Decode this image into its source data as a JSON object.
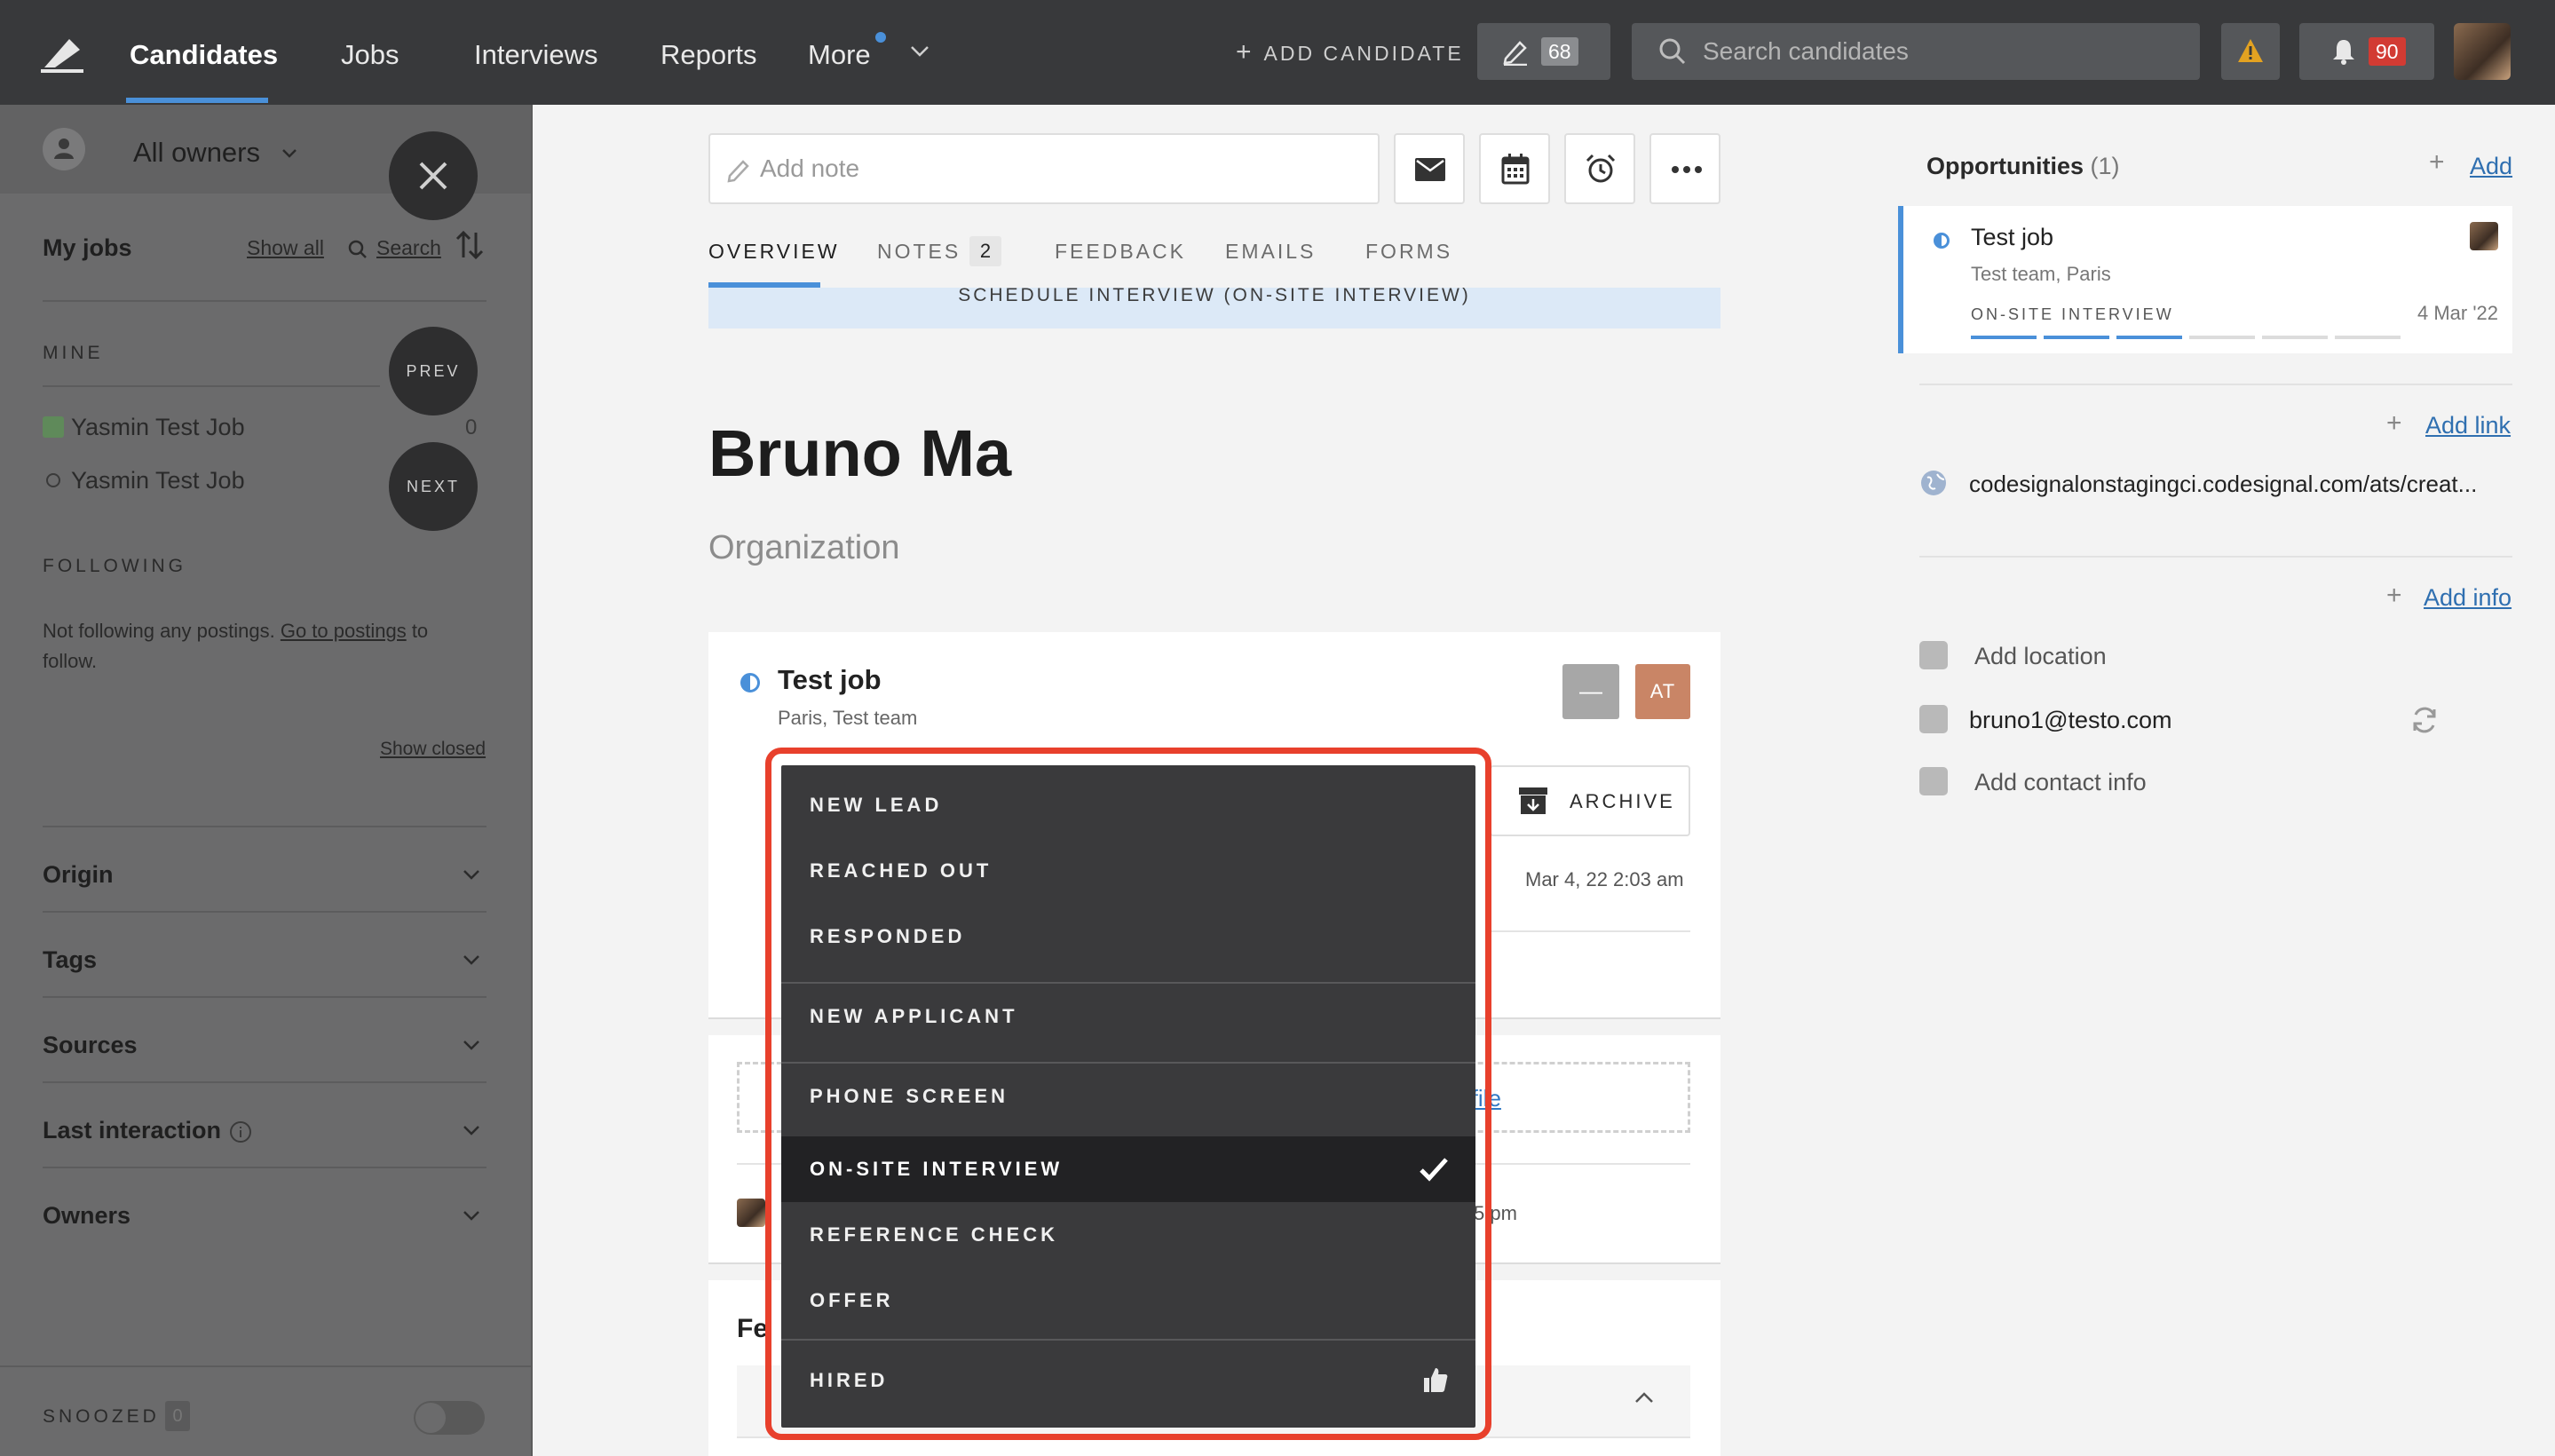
{
  "nav": {
    "items": [
      "Candidates",
      "Jobs",
      "Interviews",
      "Reports",
      "More"
    ],
    "add_candidate": "ADD CANDIDATE",
    "pending_count": "68",
    "search_placeholder": "Search candidates",
    "notification_count": "90"
  },
  "sidebar": {
    "owners": "All owners",
    "my_jobs": "My jobs",
    "show_all": "Show all",
    "search": "Search",
    "mine_label": "MINE",
    "jobs": [
      {
        "name": "Yasmin Test Job",
        "count": "0"
      },
      {
        "name": "Yasmin Test Job",
        "count": ""
      }
    ],
    "prev": "PREV",
    "next": "NEXT",
    "following_label": "FOLLOWING",
    "following_text_1": "Not following any postings. ",
    "following_link": "Go to postings",
    "following_text_2": " to follow.",
    "show_closed": "Show closed",
    "filters": [
      "Origin",
      "Tags",
      "Sources",
      "Last interaction",
      "Owners"
    ],
    "snoozed_label": "SNOOZED",
    "snoozed_count": "0"
  },
  "main": {
    "note_placeholder": "Add note",
    "tabs": [
      "OVERVIEW",
      "NOTES",
      "FEEDBACK",
      "EMAILS",
      "FORMS"
    ],
    "notes_count": "2",
    "banner": "SCHEDULE INTERVIEW (ON-SITE INTERVIEW)",
    "candidate_name": "Bruno Ma",
    "organization": "Organization",
    "job_title": "Test job",
    "job_sub": "Paris, Test team",
    "minus_badge": "—",
    "at_badge": "AT",
    "archive": "ARCHIVE",
    "date": "Mar 4, 22 2:03 am",
    "file_link": "d file",
    "row_time": "5 pm",
    "feedback_head": "Fe"
  },
  "stage_dropdown": {
    "items": [
      "NEW LEAD",
      "REACHED OUT",
      "RESPONDED",
      "NEW APPLICANT",
      "PHONE SCREEN",
      "ON-SITE INTERVIEW",
      "REFERENCE CHECK",
      "OFFER",
      "HIRED"
    ],
    "selected": "ON-SITE INTERVIEW"
  },
  "right": {
    "opportunities_label": "Opportunities",
    "opportunities_count": "(1)",
    "add": "Add",
    "opp_title": "Test job",
    "opp_sub": "Test team, Paris",
    "opp_stage": "ON-SITE INTERVIEW",
    "opp_date": "4 Mar '22",
    "add_link": "Add link",
    "link_text": "codesignalonstagingci.codesignal.com/ats/creat...",
    "add_info": "Add info",
    "add_location": "Add location",
    "email": "bruno1@testo.com",
    "add_contact": "Add contact info"
  },
  "colors": {
    "accent": "#4a90d9",
    "highlight": "#e8402c",
    "badge_red": "#d23b33"
  }
}
